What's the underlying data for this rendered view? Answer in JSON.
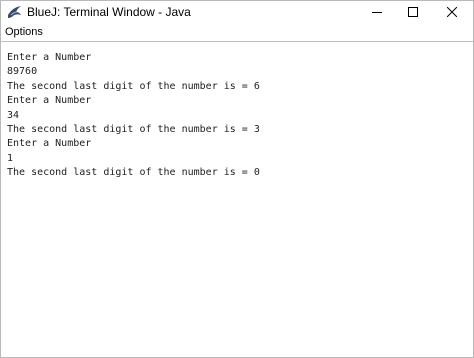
{
  "window": {
    "title": "BlueJ: Terminal Window - Java",
    "app_icon": "bluej-bird-icon",
    "controls": [
      "minimize-icon",
      "maximize-icon",
      "close-icon"
    ]
  },
  "menubar": {
    "items": [
      "Options"
    ]
  },
  "terminal": {
    "lines": [
      "Enter a Number",
      "89760",
      "The second last digit of the number is = 6",
      "Enter a Number",
      "34",
      "The second last digit of the number is = 3",
      "Enter a Number",
      "1",
      "The second last digit of the number is = 0"
    ]
  }
}
